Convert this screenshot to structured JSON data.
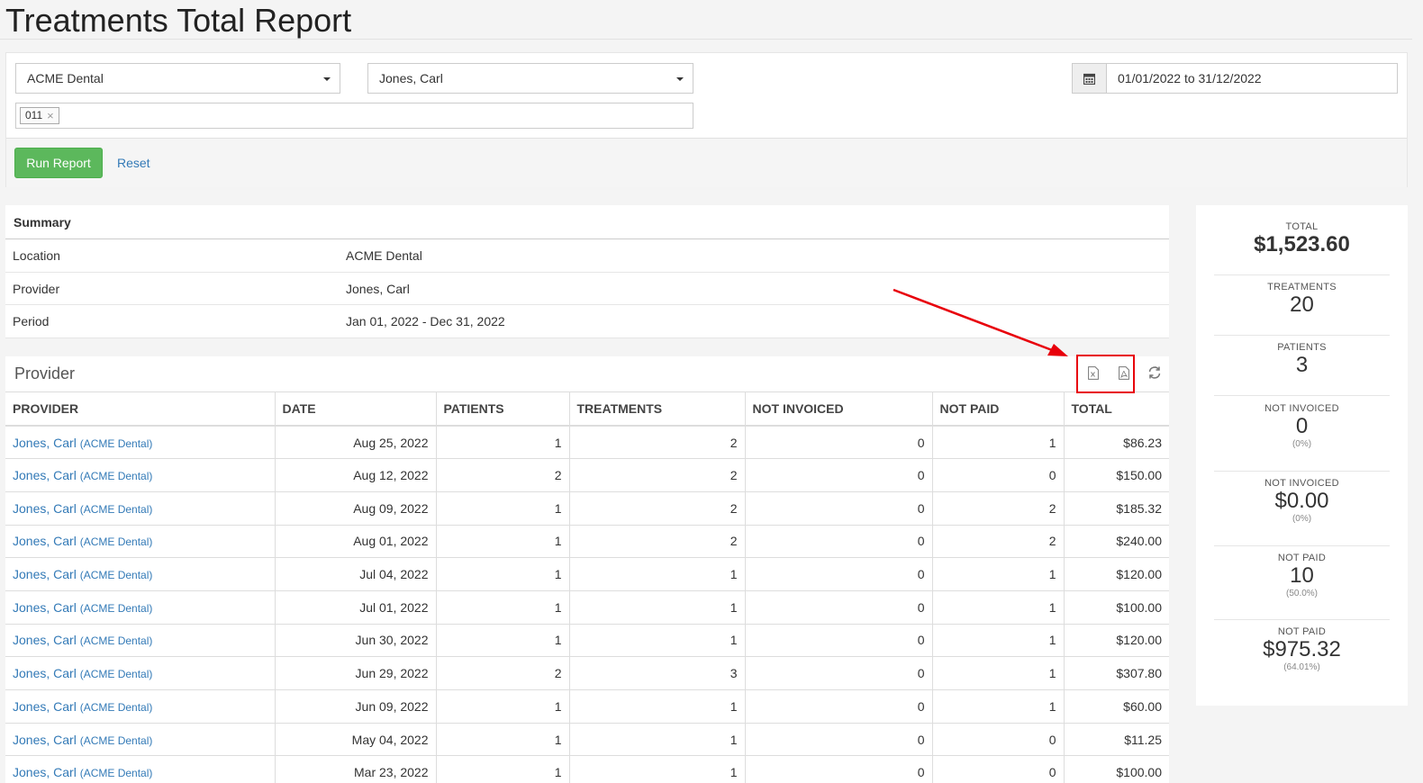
{
  "page": {
    "title": "Treatments Total Report"
  },
  "filters": {
    "location": "ACME Dental",
    "provider": "Jones, Carl",
    "tag": "011",
    "date_range": "01/01/2022 to 31/12/2022",
    "run_label": "Run Report",
    "reset_label": "Reset"
  },
  "summary": {
    "heading": "Summary",
    "rows": [
      {
        "key": "Location",
        "value": "ACME Dental"
      },
      {
        "key": "Provider",
        "value": "Jones, Carl"
      },
      {
        "key": "Period",
        "value": "Jan 01, 2022 - Dec 31, 2022"
      }
    ]
  },
  "provider_panel": {
    "heading": "Provider",
    "icons": [
      "excel-export-icon",
      "pdf-export-icon",
      "refresh-icon"
    ],
    "columns": [
      "PROVIDER",
      "DATE",
      "PATIENTS",
      "TREATMENTS",
      "NOT INVOICED",
      "NOT PAID",
      "TOTAL"
    ],
    "rows": [
      {
        "provider": "Jones, Carl",
        "location": "(ACME Dental)",
        "date": "Aug 25, 2022",
        "patients": "1",
        "treatments": "2",
        "not_invoiced": "0",
        "not_paid": "1",
        "total": "$86.23"
      },
      {
        "provider": "Jones, Carl",
        "location": "(ACME Dental)",
        "date": "Aug 12, 2022",
        "patients": "2",
        "treatments": "2",
        "not_invoiced": "0",
        "not_paid": "0",
        "total": "$150.00"
      },
      {
        "provider": "Jones, Carl",
        "location": "(ACME Dental)",
        "date": "Aug 09, 2022",
        "patients": "1",
        "treatments": "2",
        "not_invoiced": "0",
        "not_paid": "2",
        "total": "$185.32"
      },
      {
        "provider": "Jones, Carl",
        "location": "(ACME Dental)",
        "date": "Aug 01, 2022",
        "patients": "1",
        "treatments": "2",
        "not_invoiced": "0",
        "not_paid": "2",
        "total": "$240.00"
      },
      {
        "provider": "Jones, Carl",
        "location": "(ACME Dental)",
        "date": "Jul 04, 2022",
        "patients": "1",
        "treatments": "1",
        "not_invoiced": "0",
        "not_paid": "1",
        "total": "$120.00"
      },
      {
        "provider": "Jones, Carl",
        "location": "(ACME Dental)",
        "date": "Jul 01, 2022",
        "patients": "1",
        "treatments": "1",
        "not_invoiced": "0",
        "not_paid": "1",
        "total": "$100.00"
      },
      {
        "provider": "Jones, Carl",
        "location": "(ACME Dental)",
        "date": "Jun 30, 2022",
        "patients": "1",
        "treatments": "1",
        "not_invoiced": "0",
        "not_paid": "1",
        "total": "$120.00"
      },
      {
        "provider": "Jones, Carl",
        "location": "(ACME Dental)",
        "date": "Jun 29, 2022",
        "patients": "2",
        "treatments": "3",
        "not_invoiced": "0",
        "not_paid": "1",
        "total": "$307.80"
      },
      {
        "provider": "Jones, Carl",
        "location": "(ACME Dental)",
        "date": "Jun 09, 2022",
        "patients": "1",
        "treatments": "1",
        "not_invoiced": "0",
        "not_paid": "1",
        "total": "$60.00"
      },
      {
        "provider": "Jones, Carl",
        "location": "(ACME Dental)",
        "date": "May 04, 2022",
        "patients": "1",
        "treatments": "1",
        "not_invoiced": "0",
        "not_paid": "0",
        "total": "$11.25"
      },
      {
        "provider": "Jones, Carl",
        "location": "(ACME Dental)",
        "date": "Mar 23, 2022",
        "patients": "1",
        "treatments": "1",
        "not_invoiced": "0",
        "not_paid": "0",
        "total": "$100.00"
      }
    ]
  },
  "stats": [
    {
      "label": "TOTAL",
      "value": "$1,523.60",
      "pct": ""
    },
    {
      "label": "TREATMENTS",
      "value": "20",
      "pct": ""
    },
    {
      "label": "PATIENTS",
      "value": "3",
      "pct": ""
    },
    {
      "label": "NOT INVOICED",
      "value": "0",
      "pct": "(0%)"
    },
    {
      "label": "NOT INVOICED",
      "value": "$0.00",
      "pct": "(0%)"
    },
    {
      "label": "NOT PAID",
      "value": "10",
      "pct": "(50.0%)"
    },
    {
      "label": "NOT PAID",
      "value": "$975.32",
      "pct": "(64.01%)"
    }
  ],
  "colors": {
    "annotation": "#e8000b",
    "primary_button": "#5cb85c",
    "link": "#337ab7"
  }
}
